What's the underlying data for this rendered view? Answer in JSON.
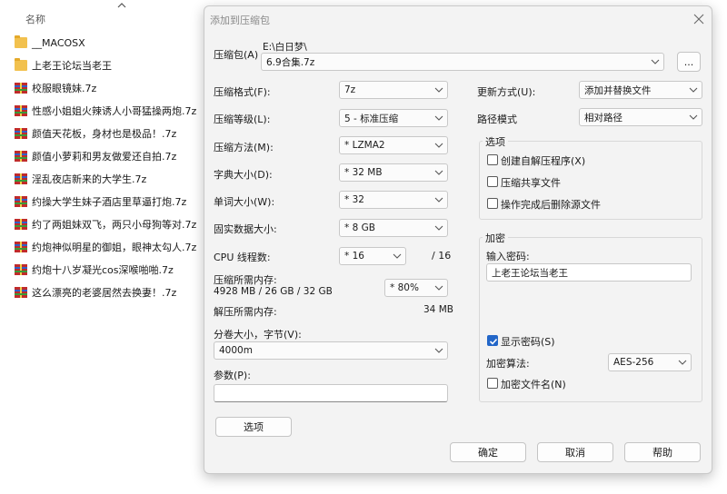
{
  "explorer": {
    "column_name": "名称",
    "files": [
      {
        "name": "__MACOSX",
        "type": "folder"
      },
      {
        "name": "上老王论坛当老王",
        "type": "folder"
      },
      {
        "name": "校服眼镜妹.7z",
        "type": "archive"
      },
      {
        "name": "性感小姐姐火辣诱人小哥猛操两炮.7z",
        "type": "archive"
      },
      {
        "name": "颜值天花板，身材也是极品！.7z",
        "type": "archive"
      },
      {
        "name": "颜值小萝莉和男友做爱还自拍.7z",
        "type": "archive"
      },
      {
        "name": "淫乱夜店新来的大学生.7z",
        "type": "archive"
      },
      {
        "name": "约操大学生妹子酒店里草逼打炮.7z",
        "type": "archive"
      },
      {
        "name": "约了两姐妹双飞，两只小母狗等对.7z",
        "type": "archive"
      },
      {
        "name": "约炮神似明星的御姐，眼神太勾人.7z",
        "type": "archive"
      },
      {
        "name": "约炮十八岁凝光cos深喉啪啪.7z",
        "type": "archive"
      },
      {
        "name": "这么漂亮的老婆居然去换妻！.7z",
        "type": "archive"
      }
    ]
  },
  "dialog": {
    "title": "添加到压缩包",
    "archive": {
      "label": "压缩包(A)",
      "path": "E:\\白日梦\\",
      "value": "6.9合集.7z",
      "browse": "..."
    },
    "format": {
      "label": "压缩格式(F):",
      "value": "7z"
    },
    "level": {
      "label": "压缩等级(L):",
      "value": "5 - 标准压缩"
    },
    "method": {
      "label": "压缩方法(M):",
      "value": "* LZMA2"
    },
    "dict": {
      "label": "字典大小(D):",
      "value": "* 32 MB"
    },
    "word": {
      "label": "单词大小(W):",
      "value": "* 32"
    },
    "solid": {
      "label": "固实数据大小:",
      "value": "* 8 GB"
    },
    "cpu": {
      "label": "CPU 线程数:",
      "value": "* 16",
      "max": "/ 16"
    },
    "mem": {
      "label": "压缩所需内存:",
      "detail": "4928 MB / 26 GB / 32 GB",
      "value": "* 80%"
    },
    "decomp": {
      "label": "解压所需内存:",
      "value": "34 MB"
    },
    "split": {
      "label": "分卷大小，字节(V):",
      "value": "4000m"
    },
    "params": {
      "label": "参数(P):",
      "value": ""
    },
    "options_button": "选项",
    "update": {
      "label": "更新方式(U):",
      "value": "添加并替换文件"
    },
    "path_mode": {
      "label": "路径模式",
      "value": "相对路径"
    },
    "options": {
      "title": "选项",
      "sfx": {
        "label": "创建自解压程序(X)",
        "checked": false
      },
      "shared": {
        "label": "压缩共享文件",
        "checked": false
      },
      "delete": {
        "label": "操作完成后删除源文件",
        "checked": false
      }
    },
    "encryption": {
      "title": "加密",
      "password_label": "输入密码:",
      "password_value": "上老王论坛当老王",
      "show_password": {
        "label": "显示密码(S)",
        "checked": true
      },
      "method_label": "加密算法:",
      "method_value": "AES-256",
      "encrypt_names": {
        "label": "加密文件名(N)",
        "checked": false
      }
    },
    "buttons": {
      "ok": "确定",
      "cancel": "取消",
      "help": "帮助"
    }
  }
}
